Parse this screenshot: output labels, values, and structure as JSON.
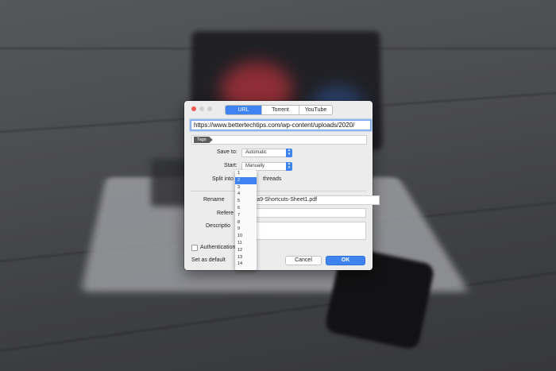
{
  "dialog": {
    "tabs": [
      {
        "label": "URL",
        "active": true
      },
      {
        "label": "Torrent",
        "active": false
      },
      {
        "label": "YouTube",
        "active": false
      }
    ],
    "url_value": "https://www.bettertechtips.com/wp-content/uploads/2020/",
    "tags_chip": "Tags",
    "save_to_label": "Save to:",
    "save_to_value": "Automatic",
    "start_label": "Start:",
    "start_value": "Manually",
    "split_label_visible": "Split into",
    "split_value": "2",
    "split_suffix": "threads",
    "rename_label_visible": "Rename",
    "rename_value_visible": "ora9-Shortcuts-Sheet1.pdf",
    "referer_label_visible": "Refere",
    "description_label_visible": "Descriptio",
    "authentication_label_visible": "Authentication",
    "set_default_label": "Set as default",
    "cancel_label": "Cancel",
    "ok_label": "OK"
  },
  "thread_options": [
    "1",
    "2",
    "3",
    "4",
    "5",
    "6",
    "7",
    "8",
    "9",
    "10",
    "11",
    "12",
    "13",
    "14"
  ],
  "selected_thread": "2",
  "colors": {
    "accent": "#3e83f0",
    "close_button": "#ec5b55",
    "dialog_bg": "#ececec"
  }
}
